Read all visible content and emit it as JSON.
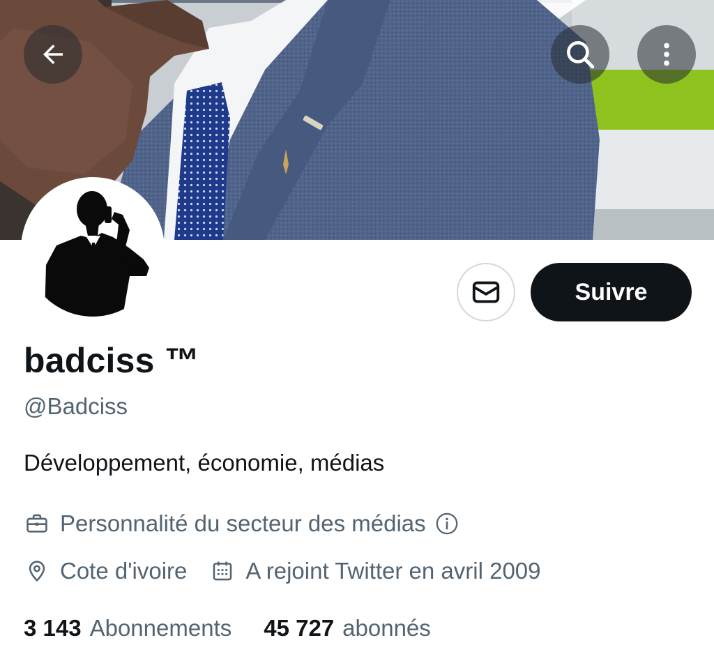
{
  "header": {
    "back_icon": "arrow-left-icon",
    "search_icon": "search-icon",
    "more_icon": "more-vertical-icon",
    "overlay_button_color": "#272c30"
  },
  "profile": {
    "display_name": "badciss ™",
    "handle": "@Badciss",
    "bio": "Développement, économie, médias",
    "category": "Personnalité du secteur des médias",
    "location": "Cote d'ivoire",
    "joined": "A rejoint Twitter en avril 2009"
  },
  "actions": {
    "message_icon": "envelope-icon",
    "follow_label": "Suivre"
  },
  "stats": {
    "following_count": "3 143",
    "following_label": "Abonnements",
    "followers_count": "45 727",
    "followers_label": "abonnés"
  },
  "colors": {
    "primary_text": "#0f1419",
    "secondary_text": "#536471",
    "follow_button_bg": "#0f1419",
    "border": "#cfd9de",
    "banner_suit": "#4a5f85",
    "banner_accent_green": "#8dc21f"
  }
}
